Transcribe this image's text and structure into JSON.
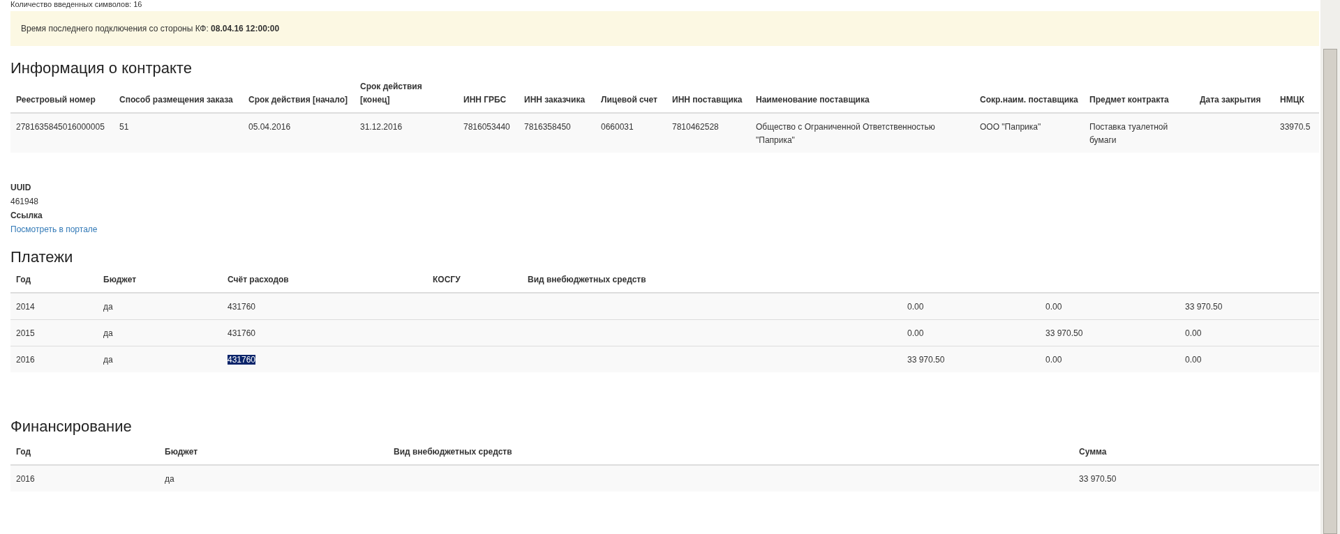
{
  "top_note": "Количество введенных символов: 16",
  "alert": {
    "label": "Время последнего подключения со стороны КФ:",
    "value": "08.04.16 12:00:00"
  },
  "contract": {
    "title": "Информация о контракте",
    "columns": [
      "Реестровый номер",
      "Способ размещения заказа",
      "Срок действия [начало]",
      "Срок действия [конец]",
      "ИНН ГРБС",
      "ИНН заказчика",
      "Лицевой счет",
      "ИНН поставщика",
      "Наименование поставщика",
      "Сокр.наим. поставщика",
      "Предмет контракта",
      "Дата закрытия",
      "НМЦК"
    ],
    "rows": [
      {
        "cells": [
          "2781635845016000005",
          "51",
          "05.04.2016",
          "31.12.2016",
          "7816053440",
          "7816358450",
          "0660031",
          "7810462528",
          "Общество с Ограниченной Ответственностью \"Паприка\"",
          "ООО \"Паприка\"",
          "Поставка туалетной бумаги",
          "",
          "33970.5"
        ]
      }
    ]
  },
  "details": [
    {
      "label": "UUID",
      "value": "461948",
      "kind": "text"
    },
    {
      "label": "Ссылка",
      "value": "Посмотреть в портале",
      "kind": "link"
    }
  ],
  "payments": {
    "title": "Платежи",
    "columns": [
      "Год",
      "Бюджет",
      "Счёт расходов",
      "КОСГУ",
      "Вид внебюджетных средств",
      "",
      "",
      ""
    ],
    "rows": [
      {
        "cells": [
          "2014",
          "да",
          "431760",
          "",
          "",
          "0.00",
          "0.00",
          "33 970.50"
        ],
        "account_selected": false
      },
      {
        "cells": [
          "2015",
          "да",
          "431760",
          "",
          "",
          "0.00",
          "33 970.50",
          "0.00"
        ],
        "account_selected": false
      },
      {
        "cells": [
          "2016",
          "да",
          "431760",
          "",
          "",
          "33 970.50",
          "0.00",
          "0.00"
        ],
        "account_selected": true
      }
    ]
  },
  "financing": {
    "title": "Финансирование",
    "columns": [
      "Год",
      "Бюджет",
      "Вид внебюджетных средств",
      "Сумма"
    ],
    "rows": [
      {
        "cells": [
          "2016",
          "да",
          "",
          "33 970.50"
        ]
      }
    ]
  }
}
